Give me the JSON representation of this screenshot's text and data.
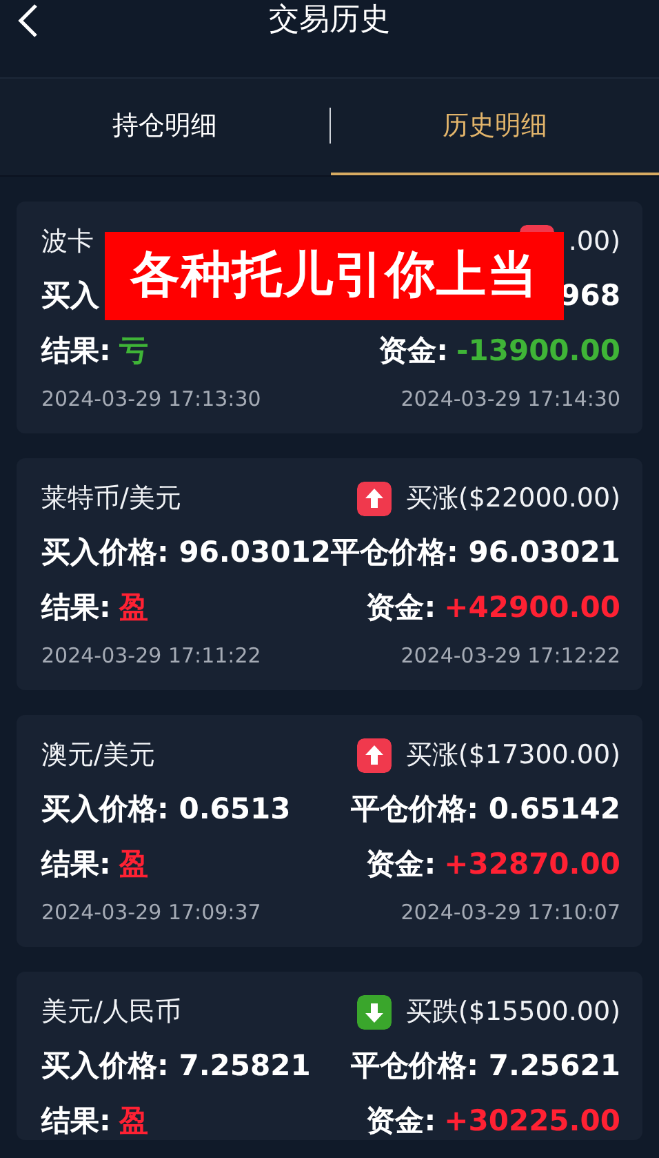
{
  "header": {
    "title": "交易历史"
  },
  "tabs": [
    {
      "label": "持仓明细",
      "selected": false
    },
    {
      "label": "历史明细",
      "selected": true
    }
  ],
  "trades": [
    {
      "name": "波卡",
      "rising": true,
      "direction_text": ".00)",
      "buy_label": "买入",
      "close_price": "968",
      "result_label": "结果:",
      "result": "亏",
      "profit": false,
      "fund_label": "资金:",
      "fund": "-13900.00",
      "open_time": "2024-03-29 17:13:30",
      "close_time": "2024-03-29 17:14:30"
    },
    {
      "name": "莱特币/美元",
      "rising": true,
      "direction_text": "买涨($22000.00)",
      "buy_label": "买入价格:",
      "buy_price": "96.03012",
      "close_label": "平仓价格:",
      "close_price": "96.03021",
      "result_label": "结果:",
      "result": "盈",
      "profit": true,
      "fund_label": "资金:",
      "fund": "+42900.00",
      "open_time": "2024-03-29 17:11:22",
      "close_time": "2024-03-29 17:12:22"
    },
    {
      "name": "澳元/美元",
      "rising": true,
      "direction_text": "买涨($17300.00)",
      "buy_label": "买入价格:",
      "buy_price": "0.6513",
      "close_label": "平仓价格:",
      "close_price": "0.65142",
      "result_label": "结果:",
      "result": "盈",
      "profit": true,
      "fund_label": "资金:",
      "fund": "+32870.00",
      "open_time": "2024-03-29 17:09:37",
      "close_time": "2024-03-29 17:10:07"
    },
    {
      "name": "美元/人民币",
      "rising": false,
      "direction_text": "买跌($15500.00)",
      "buy_label": "买入价格:",
      "buy_price": "7.25821",
      "close_label": "平仓价格:",
      "close_price": "7.25621",
      "result_label": "结果:",
      "result": "盈",
      "profit": true,
      "fund_label": "资金:",
      "fund": "+30225.00"
    }
  ],
  "banner": {
    "text": "各种托儿引你上当"
  }
}
